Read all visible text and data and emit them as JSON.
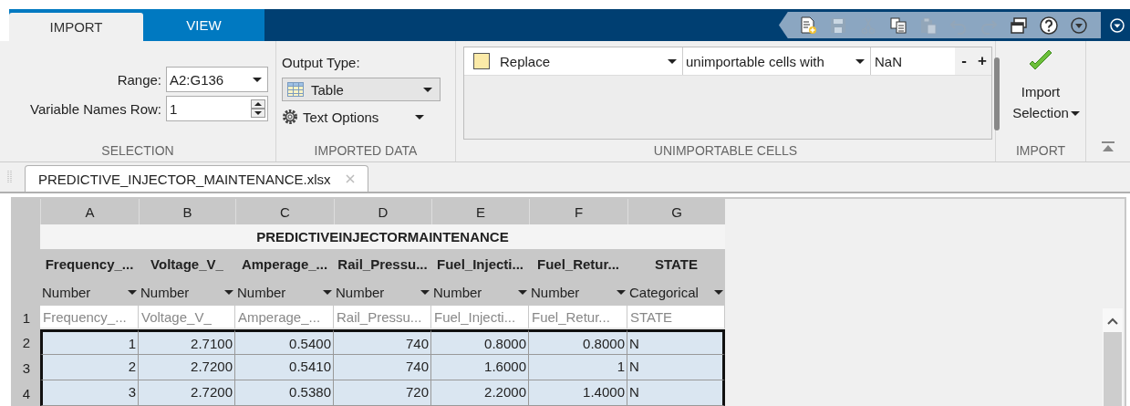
{
  "tabs": [
    {
      "label": "IMPORT",
      "selected": true
    },
    {
      "label": "VIEW",
      "selected": false
    }
  ],
  "quick_access": [
    {
      "kind": "new",
      "disabled": false
    },
    {
      "kind": "save",
      "disabled": true
    },
    {
      "kind": "cut",
      "disabled": true
    },
    {
      "kind": "copy",
      "disabled": false
    },
    {
      "kind": "paste",
      "disabled": true
    },
    {
      "kind": "undo",
      "disabled": true
    },
    {
      "kind": "redo",
      "disabled": true
    },
    {
      "kind": "layout",
      "disabled": false
    },
    {
      "kind": "help",
      "disabled": false
    },
    {
      "kind": "menu",
      "disabled": false
    }
  ],
  "selection": {
    "range_label": "Range:",
    "range": "A2:G136",
    "names_row_label": "Variable Names Row:",
    "names_row": "1",
    "section": "SELECTION"
  },
  "imported_data": {
    "output_type_label": "Output Type:",
    "output_type": "Table",
    "text_options": "Text Options",
    "section": "IMPORTED DATA"
  },
  "unimportable": {
    "rules": [
      {
        "color": "#fbeaa8",
        "action": "Replace",
        "target": "unimportable cells with",
        "value": "NaN"
      }
    ],
    "remove": "-",
    "add": "+",
    "section": "UNIMPORTABLE CELLS"
  },
  "import": {
    "button": "Import Selection",
    "section": "IMPORT"
  },
  "document_tab": {
    "title": "PREDICTIVE_INJECTOR_MAINTENANCE.xlsx",
    "selected": true
  },
  "grid": {
    "title": "PREDICTIVEINJECTORMAINTENANCE",
    "columns": [
      {
        "letter": "A",
        "name": "Frequency_...",
        "type": "Number"
      },
      {
        "letter": "B",
        "name": "Voltage_V_",
        "type": "Number"
      },
      {
        "letter": "C",
        "name": "Amperage_...",
        "type": "Number"
      },
      {
        "letter": "D",
        "name": "Rail_Pressu...",
        "type": "Number"
      },
      {
        "letter": "E",
        "name": "Fuel_Injecti...",
        "type": "Number"
      },
      {
        "letter": "F",
        "name": "Fuel_Retur...",
        "type": "Number"
      },
      {
        "letter": "G",
        "name": "STATE",
        "type": "Categorical"
      }
    ],
    "header_row": {
      "number": "1",
      "cells": [
        "Frequency_...",
        "Voltage_V_",
        "Amperage_...",
        "Rail_Pressu...",
        "Fuel_Injecti...",
        "Fuel_Retur...",
        "STATE"
      ]
    },
    "rows": [
      {
        "number": "2",
        "selected": true,
        "cells": [
          "1",
          "2.7100",
          "0.5400",
          "740",
          "0.8000",
          "0.8000",
          "N"
        ]
      },
      {
        "number": "3",
        "selected": true,
        "cells": [
          "2",
          "2.7200",
          "0.5410",
          "740",
          "1.6000",
          "1",
          "N"
        ]
      },
      {
        "number": "4",
        "selected": true,
        "cells": [
          "3",
          "2.7200",
          "0.5380",
          "720",
          "2.2000",
          "1.4000",
          "N"
        ]
      }
    ]
  }
}
